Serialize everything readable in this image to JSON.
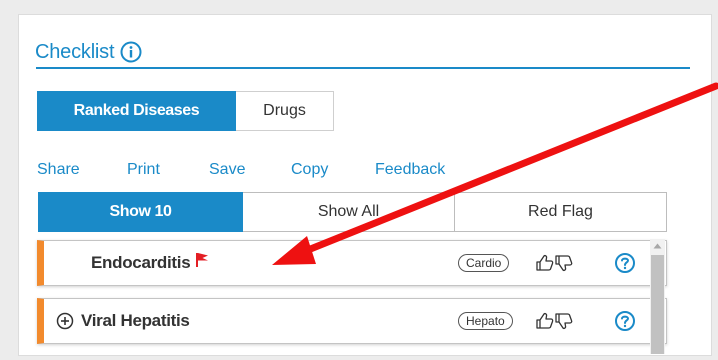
{
  "header": {
    "title": "Checklist",
    "info_icon": "info-icon"
  },
  "tabs": [
    {
      "label": "Ranked Diseases",
      "active": true
    },
    {
      "label": "Drugs",
      "active": false
    }
  ],
  "actions": [
    "Share",
    "Print",
    "Save",
    "Copy",
    "Feedback"
  ],
  "filters": [
    {
      "label": "Show 10",
      "active": true
    },
    {
      "label": "Show All",
      "active": false
    },
    {
      "label": "Red Flag",
      "active": false
    }
  ],
  "diseases": [
    {
      "name": "Endocarditis",
      "tag": "Cardio",
      "red_flag": true,
      "expandable": false
    },
    {
      "name": "Viral Hepatitis",
      "tag": "Hepato",
      "red_flag": false,
      "expandable": true
    }
  ],
  "colors": {
    "accent": "#1a8ac8",
    "row_marker": "#f28a2d",
    "red_flag": "#e31e24",
    "annotation_arrow": "#ee1111"
  }
}
